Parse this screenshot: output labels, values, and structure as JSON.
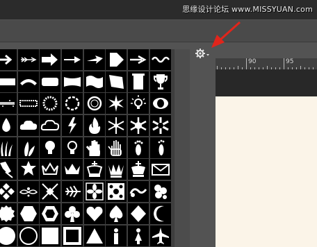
{
  "watermark": {
    "text": "思缘设计论坛 www.MISSYUAN.com"
  },
  "ruler": {
    "labels": [
      "90",
      "95"
    ]
  },
  "shape_panel": {
    "rows": [
      [
        "arrow-icon",
        "feather-arrow-icon",
        "arrow-thick-icon",
        "arrow-thin-icon",
        "arrow-pointer-icon",
        "arrow-pentagon-icon",
        "arrow-right-icon",
        "squiggle-icon"
      ],
      [
        "banner-icon",
        "ribbon-banner-icon",
        "tag-icon",
        "scroll-banner-icon",
        "wave-banner-icon",
        "flag-banner-icon",
        "sign-icon",
        "trophy-icon"
      ],
      [
        "grunge-frame-icon",
        "stamp-frame-icon",
        "fuzzy-circle-icon",
        "splash-circle-icon",
        "ring-frame-icon",
        "burst-icon",
        "lightbulb-idea-icon",
        "eye-icon"
      ],
      [
        "raindrop-icon",
        "cloud-icon",
        "thought-cloud-icon",
        "lightning-icon",
        "fire-icon",
        "snowflake-icon",
        "snowflake-2-icon",
        "snowflake-3-icon"
      ],
      [
        "grass-icon",
        "leaves-icon",
        "lightbulb-icon",
        "lightbulb-outline-icon",
        "hand-icon",
        "hand-outline-icon",
        "footprint-icon",
        "footprint-2-icon"
      ],
      [
        "pin-icon",
        "star-badge-icon",
        "crown-outline-icon",
        "crown-icon",
        "king-icon",
        "queen-icon",
        "king-2-icon",
        "envelope-icon"
      ],
      [
        "diamond-pattern-icon",
        "ornament-icon",
        "cross-pattern-icon",
        "fern-icon",
        "floral-tile-icon",
        "floral-tile-2-icon",
        "swirl-icon",
        "floral-cluster-icon"
      ],
      [
        "seal-icon",
        "hexagon-icon",
        "hexagon-outline-icon",
        "club-icon",
        "heart-icon",
        "spade-icon",
        "diamond-icon",
        "moon-icon"
      ],
      [
        "circle-icon",
        "circle-outline-icon",
        "square-icon",
        "square-outline-icon",
        "triangle-icon",
        "male-icon",
        "female-icon",
        "airplane-icon"
      ]
    ]
  }
}
